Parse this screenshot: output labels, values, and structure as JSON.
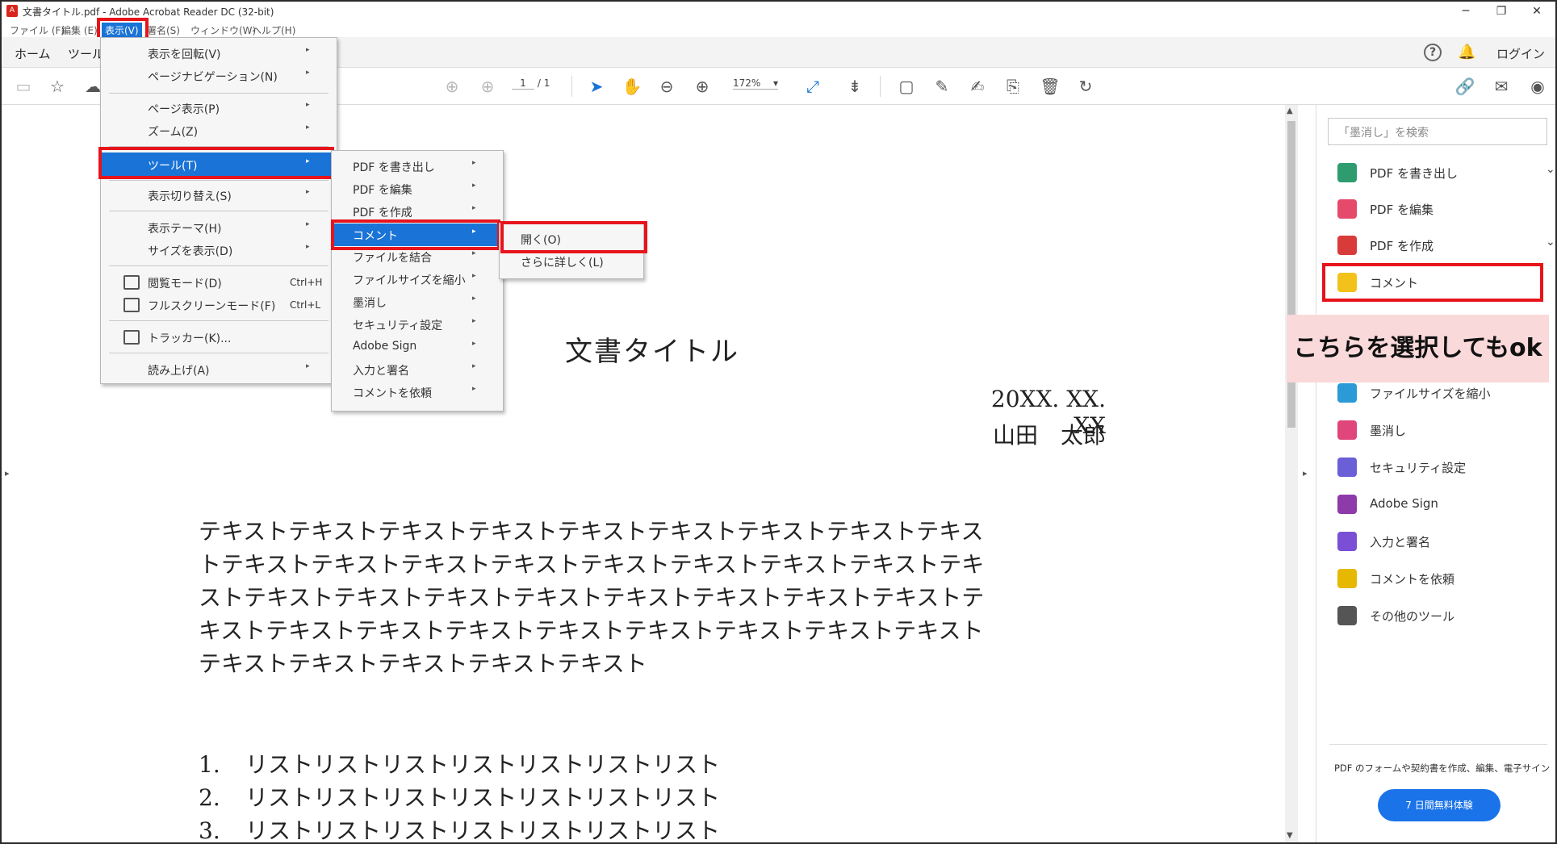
{
  "window": {
    "title": "文書タイトル.pdf - Adobe Acrobat Reader DC (32-bit)",
    "minimize": "─",
    "restore": "❐",
    "close": "✕"
  },
  "menubar": [
    {
      "label": "ファイル (F)"
    },
    {
      "label": "編集 (E)"
    },
    {
      "label": "表示(V)"
    },
    {
      "label": "署名(S)"
    },
    {
      "label": "ウィンドウ(W)"
    },
    {
      "label": "ヘルプ(H)"
    }
  ],
  "tabs": {
    "home": "ホーム",
    "tools": "ツール",
    "help_icon": "?",
    "login": "ログイン"
  },
  "toolbar": {
    "page_current": "1",
    "page_sep": "/",
    "page_total": "1",
    "zoom": "172%"
  },
  "view_menu": [
    {
      "label": "表示を回転(V)",
      "submenu": true
    },
    {
      "label": "ページナビゲーション(N)",
      "submenu": true
    },
    {
      "label": "ページ表示(P)",
      "submenu": true
    },
    {
      "label": "ズーム(Z)",
      "submenu": true
    },
    {
      "label": "ツール(T)",
      "submenu": true
    },
    {
      "label": "表示切り替え(S)",
      "submenu": true
    },
    {
      "label": "表示テーマ(H)",
      "submenu": true
    },
    {
      "label": "サイズを表示(D)",
      "submenu": true
    },
    {
      "label": "閲覧モード(D)",
      "shortcut": "Ctrl+H"
    },
    {
      "label": "フルスクリーンモード(F)",
      "shortcut": "Ctrl+L"
    },
    {
      "label": "トラッカー(K)..."
    },
    {
      "label": "読み上げ(A)",
      "submenu": true
    }
  ],
  "tools_submenu": [
    {
      "label": "PDF を書き出し"
    },
    {
      "label": "PDF を編集"
    },
    {
      "label": "PDF を作成"
    },
    {
      "label": "コメント"
    },
    {
      "label": "ファイルを結合"
    },
    {
      "label": "ファイルサイズを縮小"
    },
    {
      "label": "墨消し"
    },
    {
      "label": "セキュリティ設定"
    },
    {
      "label": "Adobe Sign"
    },
    {
      "label": "入力と署名"
    },
    {
      "label": "コメントを依頼"
    }
  ],
  "comment_submenu": [
    {
      "label": "開く(O)"
    },
    {
      "label": "さらに詳しく(L)"
    }
  ],
  "document": {
    "title": "文書タイトル",
    "date": "20XX. XX. XX",
    "author": "山田　太郎",
    "body_lines": [
      "テキストテキストテキストテキストテキストテキストテキストテキストテキス",
      "トテキストテキストテキストテキストテキストテキストテキストテキストテキ",
      "ストテキストテキストテキストテキストテキストテキストテキストテキストテ",
      "キストテキストテキストテキストテキストテキストテキストテキストテキスト",
      "テキストテキストテキストテキストテキスト"
    ],
    "list": [
      {
        "num": "1.",
        "text": "リストリストリストリストリストリストリスト"
      },
      {
        "num": "2.",
        "text": "リストリストリストリストリストリストリスト"
      },
      {
        "num": "3.",
        "text": "リストリストリストリストリストリストリスト"
      }
    ]
  },
  "right_pane": {
    "search_placeholder": "「墨消し」を検索",
    "tools": [
      {
        "label": "PDF を書き出し",
        "color": "#2e9c6e",
        "expand": true
      },
      {
        "label": "PDF を編集",
        "color": "#e64a6a"
      },
      {
        "label": "PDF を作成",
        "color": "#d93a3a",
        "expand": true
      },
      {
        "label": "コメント",
        "color": "#f2c21b"
      },
      {
        "label": "ファイルサイズを縮小",
        "color": "#2b9ad6"
      },
      {
        "label": "墨消し",
        "color": "#e0457b"
      },
      {
        "label": "セキュリティ設定",
        "color": "#6a5fd6"
      },
      {
        "label": "Adobe Sign",
        "color": "#8e3aa8"
      },
      {
        "label": "入力と署名",
        "color": "#7a4fd6"
      },
      {
        "label": "コメントを依頼",
        "color": "#e6b800"
      },
      {
        "label": "その他のツール",
        "color": "#555555"
      }
    ],
    "footer_text": "PDF のフォームや契約書を作成、編集、電子サイン",
    "trial_button": "7 日間無料体験"
  },
  "callout": "こちらを選択してもok",
  "colors": {
    "highlight": "#1a73d6",
    "annotation_red": "#e8141c",
    "callout_bg": "#f9d9da",
    "trial_blue": "#1a73e8"
  }
}
